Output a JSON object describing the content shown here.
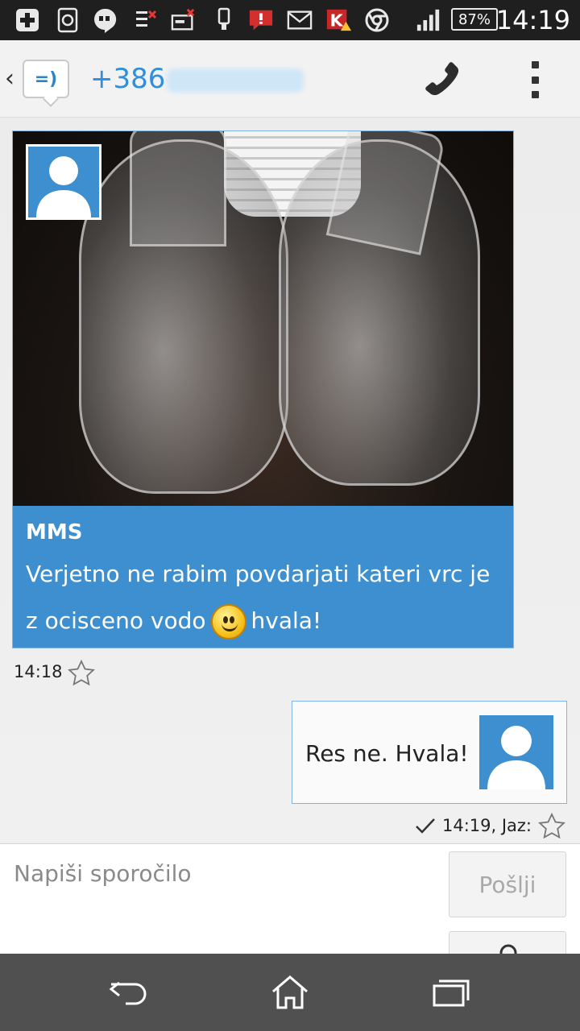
{
  "status_bar": {
    "time": "14:19",
    "battery": "87%",
    "icons": [
      "plus-icon",
      "sync-icon",
      "hangouts-icon",
      "notification-icon",
      "sim-icon",
      "usb-icon",
      "message-alert-icon",
      "gmail-icon",
      "kaspersky-icon",
      "chrome-icon",
      "signal-icon"
    ]
  },
  "header": {
    "contact": "+386",
    "call_icon": "phone-icon",
    "menu_icon": "overflow-menu-icon",
    "logo_glyph": "=)"
  },
  "messages": {
    "incoming": {
      "type_label": "MMS",
      "text_before": "Verjetno ne rabim povdarjati kateri vrc je z ocisceno vodo",
      "text_after": "hvala!",
      "time": "14:18"
    },
    "outgoing": {
      "text": "Res ne. Hvala!",
      "time": "14:19, Jaz:"
    }
  },
  "composer": {
    "placeholder": "Napiši sporočilo",
    "send_label": "Pošlji"
  },
  "colors": {
    "accent": "#3d8fcf",
    "contact_text": "#2f8fdc",
    "navbar": "#505050",
    "statusbar": "#1f1f1f"
  }
}
